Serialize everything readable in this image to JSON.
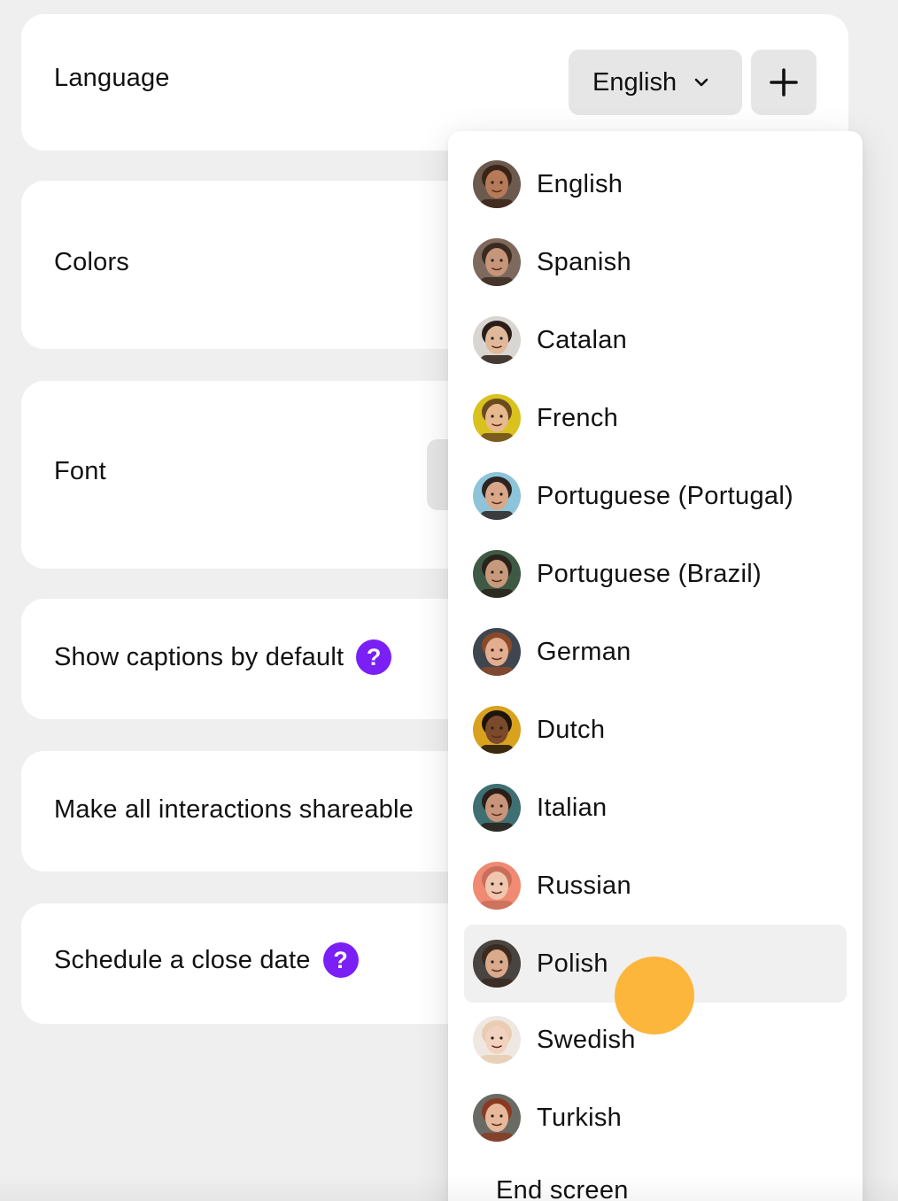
{
  "settings": {
    "language_label": "Language",
    "colors_label": "Colors",
    "font_label": "Font",
    "captions_label": "Show captions by default",
    "share_label": "Make all interactions shareable",
    "schedule_label": "Schedule a close date",
    "help_glyph": "?"
  },
  "language_select": {
    "selected": "English",
    "add_glyph": "+"
  },
  "dropdown": {
    "options": [
      {
        "label": "English",
        "avatar": "avatar-man-beard-dark",
        "skin": "#b77a58",
        "hair": "#3a2418",
        "bg": "#6b5a4d"
      },
      {
        "label": "Spanish",
        "avatar": "avatar-woman-glasses",
        "skin": "#c6957a",
        "hair": "#3b2a20",
        "bg": "#7d6a5c"
      },
      {
        "label": "Catalan",
        "avatar": "avatar-man-mustache",
        "skin": "#e0b89a",
        "hair": "#2a1e18",
        "bg": "#d9d6d2"
      },
      {
        "label": "French",
        "avatar": "avatar-woman-smiling",
        "skin": "#e8b88e",
        "hair": "#6a4a1e",
        "bg": "#d9c21e"
      },
      {
        "label": "Portuguese (Portugal)",
        "avatar": "avatar-man-glasses-beard",
        "skin": "#d9a888",
        "hair": "#2b2421",
        "bg": "#8ec4da"
      },
      {
        "label": "Portuguese (Brazil)",
        "avatar": "avatar-man-green",
        "skin": "#c89a7c",
        "hair": "#2a221c",
        "bg": "#3e5a44"
      },
      {
        "label": "German",
        "avatar": "avatar-man-red-beard",
        "skin": "#e3ad8f",
        "hair": "#8a4a2a",
        "bg": "#3f4650"
      },
      {
        "label": "Dutch",
        "avatar": "avatar-man-curly",
        "skin": "#7a4a2a",
        "hair": "#1e140c",
        "bg": "#d9a21e"
      },
      {
        "label": "Italian",
        "avatar": "avatar-man-teal",
        "skin": "#c8957a",
        "hair": "#2a2019",
        "bg": "#3e6f73"
      },
      {
        "label": "Russian",
        "avatar": "avatar-woman-coral",
        "skin": "#efc7ae",
        "hair": "#c86e5a",
        "bg": "#f08a72"
      },
      {
        "label": "Polish",
        "avatar": "avatar-woman-dark",
        "skin": "#d9aa8c",
        "hair": "#3a2a22",
        "bg": "#4a4440"
      },
      {
        "label": "Swedish",
        "avatar": "avatar-woman-blonde",
        "skin": "#f2d2be",
        "hair": "#e8cdb0",
        "bg": "#efe8e2"
      },
      {
        "label": "Turkish",
        "avatar": "avatar-woman-red-hair",
        "skin": "#e8b89a",
        "hair": "#8a3a22",
        "bg": "#6a6a64"
      }
    ],
    "end_label": "End screen"
  },
  "colors": {
    "help_purple": "#7a1ff5",
    "cursor": "#fbb63b",
    "highlight": "#f0f0f0"
  }
}
